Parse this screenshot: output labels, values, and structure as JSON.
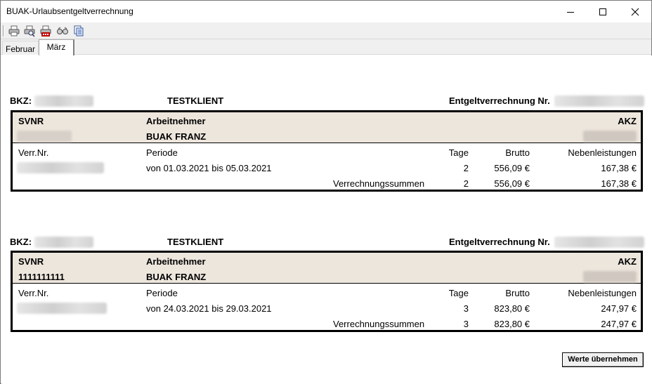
{
  "window": {
    "title": "BUAK-Urlaubsentgeltverrechnung"
  },
  "toolbar": {
    "buttons": [
      {
        "name": "print-icon"
      },
      {
        "name": "print-preview-icon"
      },
      {
        "name": "print-pdf-icon"
      },
      {
        "name": "view-icon"
      },
      {
        "name": "copy-icon"
      }
    ]
  },
  "tabs": [
    {
      "label": "Februar",
      "selected": false
    },
    {
      "label": "März",
      "selected": true
    }
  ],
  "labels": {
    "bkz": "BKZ:",
    "entgeltverrechnung": "Entgeltverrechnung Nr.",
    "svnr": "SVNR",
    "arbeitnehmer": "Arbeitnehmer",
    "akz": "AKZ",
    "verr_nr": "Verr.Nr.",
    "periode": "Periode",
    "tage": "Tage",
    "brutto": "Brutto",
    "nebenleistungen": "Nebenleistungen",
    "summen": "Verrechnungssummen"
  },
  "entries": [
    {
      "client": "TESTKLIENT",
      "svnr": "",
      "employee": "BUAK FRANZ",
      "period": "von 01.03.2021 bis 05.03.2021",
      "days": "2",
      "gross": "556,09 €",
      "extras": "167,38 €",
      "sum_days": "2",
      "sum_gross": "556,09 €",
      "sum_extras": "167,38 €"
    },
    {
      "client": "TESTKLIENT",
      "svnr": "1111111111",
      "employee": "BUAK FRANZ",
      "period": "von 24.03.2021 bis 29.03.2021",
      "days": "3",
      "gross": "823,80 €",
      "extras": "247,97 €",
      "sum_days": "3",
      "sum_gross": "823,80 €",
      "sum_extras": "247,97 €"
    }
  ],
  "action_button": "Werte übernehmen"
}
